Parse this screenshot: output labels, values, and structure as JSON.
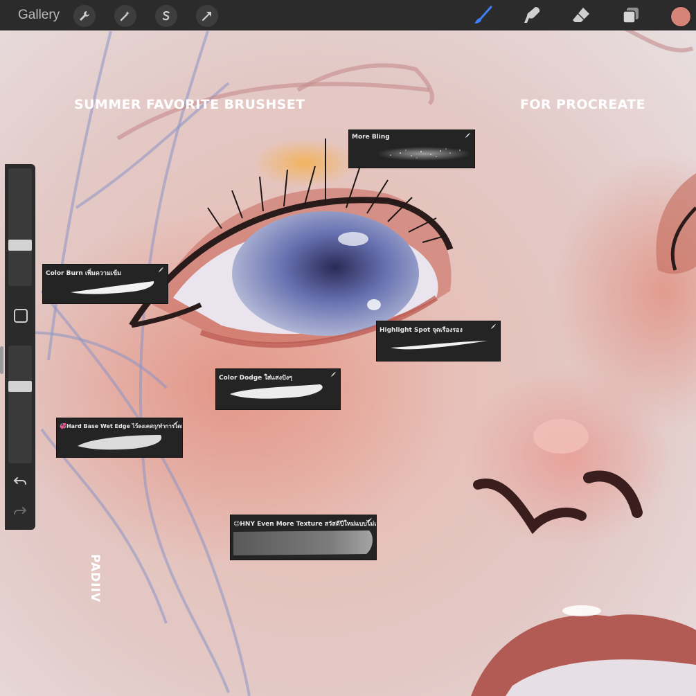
{
  "topbar": {
    "gallery_label": "Gallery",
    "actions": [
      "wrench-icon",
      "magic-wand-icon",
      "selection-icon",
      "transform-arrow-icon"
    ],
    "tools": [
      "brush-icon",
      "smudge-icon",
      "eraser-icon",
      "layers-icon"
    ],
    "active_tool": "brush",
    "active_color": "#d68478",
    "active_tool_color": "#3f7ff7"
  },
  "sidebar": {
    "brush_size_level": 0.66,
    "opacity_level": 0.55,
    "undo_icon": "undo-icon",
    "redo_icon": "redo-icon"
  },
  "artwork": {
    "title_left": "SUMMER FAVORITE BRUSHSET",
    "title_right": "FOR PROCREATE",
    "signature": "PADIIV"
  },
  "brush_cards": [
    {
      "name": "More Bling"
    },
    {
      "name": "Color Burn เพิ่มความเข้ม"
    },
    {
      "name": "Highlight Spot จุดเรืองรอง"
    },
    {
      "name": "Color Dodge ใส่แสงปังๆ"
    },
    {
      "name": "💞Hard Base Wet Edge ไว้ลงเคสกุ/ทำการไดล้วนดี"
    },
    {
      "name": "😉HNY Even More Texture สวัสดีปีใหม่แบบไม่เ..."
    }
  ]
}
